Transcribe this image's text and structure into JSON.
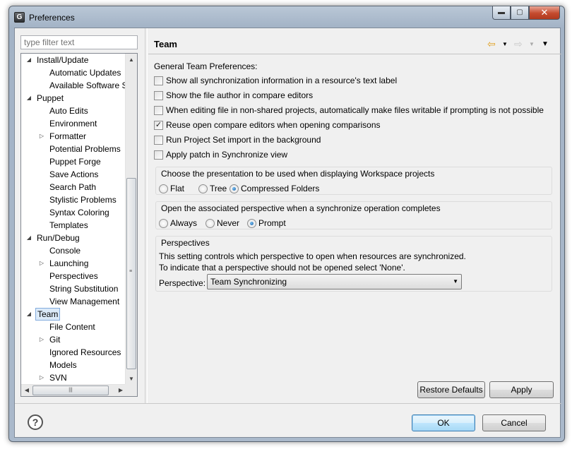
{
  "window": {
    "title": "Preferences",
    "app_icon_letter": "G",
    "controls": {
      "minimize": "▬",
      "maximize": "▢",
      "close": "✕"
    }
  },
  "sidebar": {
    "filter_placeholder": "type filter text",
    "tree": [
      {
        "label": "Install/Update",
        "level": 0,
        "expander": "expanded"
      },
      {
        "label": "Automatic Updates",
        "level": 1,
        "expander": "none"
      },
      {
        "label": "Available Software S",
        "level": 1,
        "expander": "none"
      },
      {
        "label": "Puppet",
        "level": 0,
        "expander": "expanded"
      },
      {
        "label": "Auto Edits",
        "level": 1,
        "expander": "none"
      },
      {
        "label": "Environment",
        "level": 1,
        "expander": "none"
      },
      {
        "label": "Formatter",
        "level": 1,
        "expander": "collapsed"
      },
      {
        "label": "Potential Problems",
        "level": 1,
        "expander": "none"
      },
      {
        "label": "Puppet Forge",
        "level": 1,
        "expander": "none"
      },
      {
        "label": "Save Actions",
        "level": 1,
        "expander": "none"
      },
      {
        "label": "Search Path",
        "level": 1,
        "expander": "none"
      },
      {
        "label": "Stylistic Problems",
        "level": 1,
        "expander": "none"
      },
      {
        "label": "Syntax Coloring",
        "level": 1,
        "expander": "none"
      },
      {
        "label": "Templates",
        "level": 1,
        "expander": "none"
      },
      {
        "label": "Run/Debug",
        "level": 0,
        "expander": "expanded"
      },
      {
        "label": "Console",
        "level": 1,
        "expander": "none"
      },
      {
        "label": "Launching",
        "level": 1,
        "expander": "collapsed"
      },
      {
        "label": "Perspectives",
        "level": 1,
        "expander": "none"
      },
      {
        "label": "String Substitution",
        "level": 1,
        "expander": "none"
      },
      {
        "label": "View Management",
        "level": 1,
        "expander": "none"
      },
      {
        "label": "Team",
        "level": 0,
        "expander": "expanded",
        "selected": true
      },
      {
        "label": "File Content",
        "level": 1,
        "expander": "none"
      },
      {
        "label": "Git",
        "level": 1,
        "expander": "collapsed"
      },
      {
        "label": "Ignored Resources",
        "level": 1,
        "expander": "none"
      },
      {
        "label": "Models",
        "level": 1,
        "expander": "none"
      },
      {
        "label": "SVN",
        "level": 1,
        "expander": "collapsed"
      }
    ]
  },
  "page": {
    "title": "Team",
    "section_label": "General Team Preferences:",
    "options": [
      {
        "label": "Show all synchronization information in a resource's text label",
        "checked": false
      },
      {
        "label": "Show the file author in compare editors",
        "checked": false
      },
      {
        "label": "When editing file in non-shared projects, automatically make files writable if prompting is not possible",
        "checked": false
      },
      {
        "label": "Reuse open compare editors when opening comparisons",
        "checked": true
      },
      {
        "label": "Run Project Set import in the background",
        "checked": false
      },
      {
        "label": "Apply patch in Synchronize view",
        "checked": false
      }
    ],
    "presentation_group": {
      "title": "Choose the presentation to be used when displaying Workspace projects",
      "choices": [
        {
          "label": "Flat",
          "selected": false
        },
        {
          "label": "Tree",
          "selected": false
        },
        {
          "label": "Compressed Folders",
          "selected": true
        }
      ]
    },
    "perspective_open_group": {
      "title": "Open the associated perspective when a synchronize operation completes",
      "choices": [
        {
          "label": "Always",
          "selected": false
        },
        {
          "label": "Never",
          "selected": false
        },
        {
          "label": "Prompt",
          "selected": true
        }
      ]
    },
    "perspectives_group": {
      "title": "Perspectives",
      "line1": "This setting controls which perspective to open when resources are synchronized.",
      "line2": "To indicate that a perspective should not be opened select 'None'.",
      "field_label": "Perspective:",
      "selected_value": "Team Synchronizing"
    },
    "restore_defaults_label": "Restore Defaults",
    "apply_label": "Apply"
  },
  "footer": {
    "help_glyph": "?",
    "ok_label": "OK",
    "cancel_label": "Cancel"
  },
  "colors": {
    "accent": "#3c7fb1",
    "selection": "#dbeaf9",
    "nav_arrow": "#e0a020",
    "close_button": "#c44a2e"
  }
}
